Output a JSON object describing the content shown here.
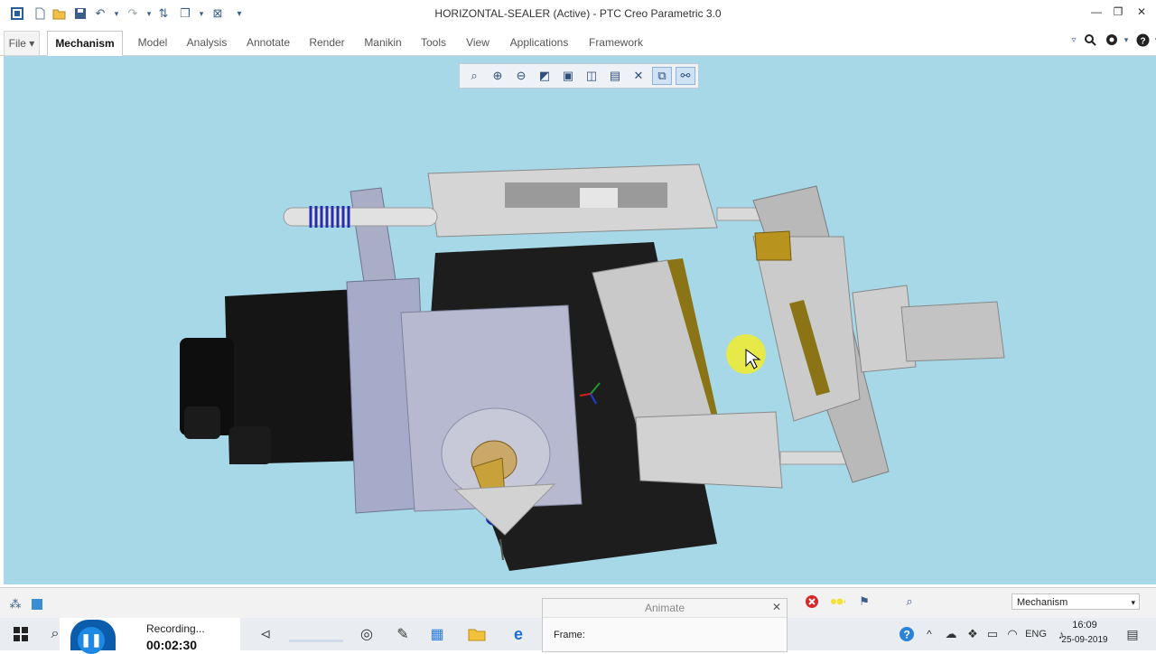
{
  "window": {
    "title": "HORIZONTAL-SEALER (Active) - PTC Creo Parametric 3.0"
  },
  "ribbon": {
    "tabs": [
      {
        "label": "File ▾"
      },
      {
        "label": "Mechanism"
      },
      {
        "label": "Model"
      },
      {
        "label": "Analysis"
      },
      {
        "label": "Annotate"
      },
      {
        "label": "Render"
      },
      {
        "label": "Manikin"
      },
      {
        "label": "Tools"
      },
      {
        "label": "View"
      },
      {
        "label": "Applications"
      },
      {
        "label": "Framework"
      }
    ],
    "active_tab": "Mechanism"
  },
  "animate_dialog": {
    "title": "Animate",
    "frame_label": "Frame:"
  },
  "status": {
    "mechanism_selector": "Mechanism"
  },
  "recorder": {
    "status": "Recording...",
    "time": "00:02:30"
  },
  "taskbar": {
    "language": "ENG",
    "time": "16:09",
    "date": "25-09-2019"
  },
  "colors": {
    "viewport_bg": "#a6d8e8",
    "taskbar_bg": "#e9edf2",
    "accent": "#1f6fd1"
  }
}
